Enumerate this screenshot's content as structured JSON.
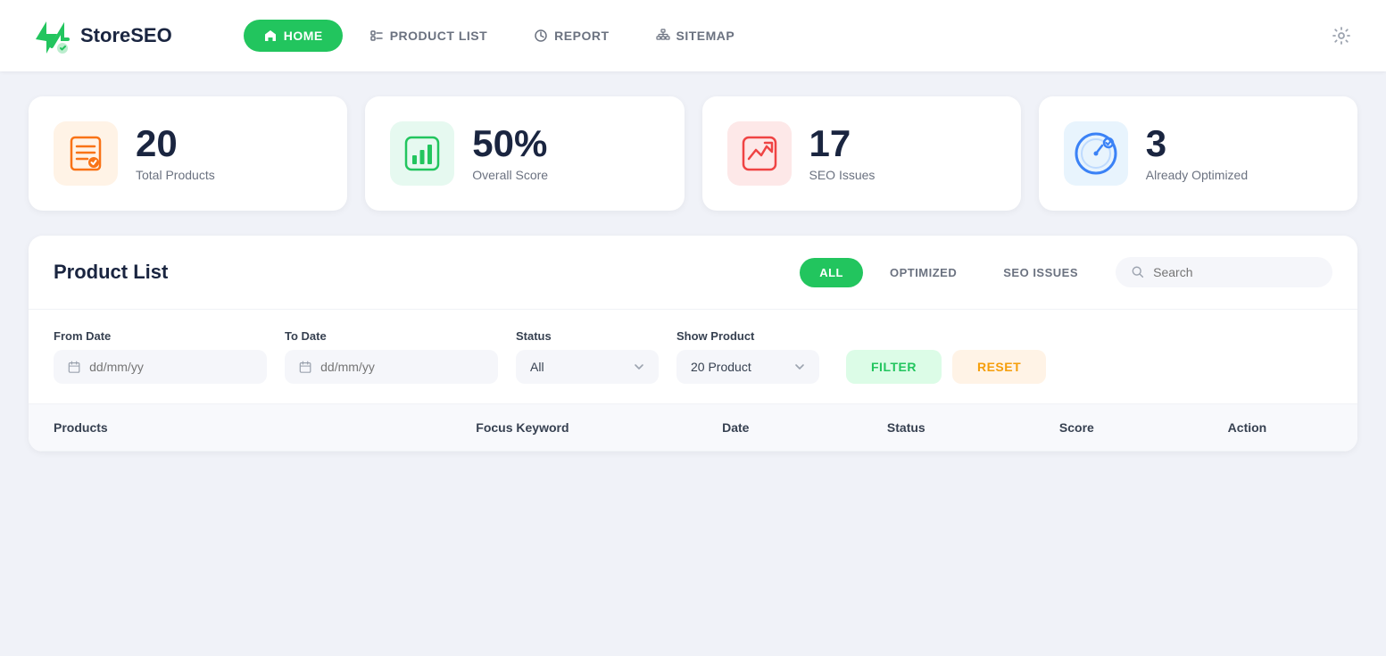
{
  "app": {
    "name": "StoreSEO",
    "logo_alt": "StoreSEO logo"
  },
  "nav": {
    "items": [
      {
        "id": "home",
        "label": "HOME",
        "active": true
      },
      {
        "id": "product-list",
        "label": "PRODUCT LIST",
        "active": false
      },
      {
        "id": "report",
        "label": "REPORT",
        "active": false
      },
      {
        "id": "sitemap",
        "label": "SITEMAP",
        "active": false
      }
    ]
  },
  "stats": [
    {
      "id": "total-products",
      "number": "20",
      "label": "Total Products",
      "color": "orange"
    },
    {
      "id": "overall-score",
      "number": "50%",
      "label": "Overall Score",
      "color": "green"
    },
    {
      "id": "seo-issues",
      "number": "17",
      "label": "SEO Issues",
      "color": "red"
    },
    {
      "id": "already-optimized",
      "number": "3",
      "label": "Already Optimized",
      "color": "blue"
    }
  ],
  "product_list": {
    "title": "Product List",
    "filter_tabs": [
      {
        "id": "all",
        "label": "ALL",
        "active": true
      },
      {
        "id": "optimized",
        "label": "OPTIMIZED",
        "active": false
      },
      {
        "id": "seo-issues",
        "label": "SEO ISSUES",
        "active": false
      }
    ],
    "search_placeholder": "Search"
  },
  "filters": {
    "from_date_label": "From Date",
    "from_date_placeholder": "dd/mm/yy",
    "to_date_label": "To Date",
    "to_date_placeholder": "dd/mm/yy",
    "status_label": "Status",
    "status_value": "All",
    "show_product_label": "Show Product",
    "show_product_value": "20 Product",
    "filter_button": "FILTER",
    "reset_button": "RESET"
  },
  "table": {
    "columns": [
      {
        "id": "products",
        "label": "Products"
      },
      {
        "id": "focus-keyword",
        "label": "Focus Keyword"
      },
      {
        "id": "date",
        "label": "Date"
      },
      {
        "id": "status",
        "label": "Status"
      },
      {
        "id": "score",
        "label": "Score"
      },
      {
        "id": "action",
        "label": "Action"
      }
    ]
  }
}
